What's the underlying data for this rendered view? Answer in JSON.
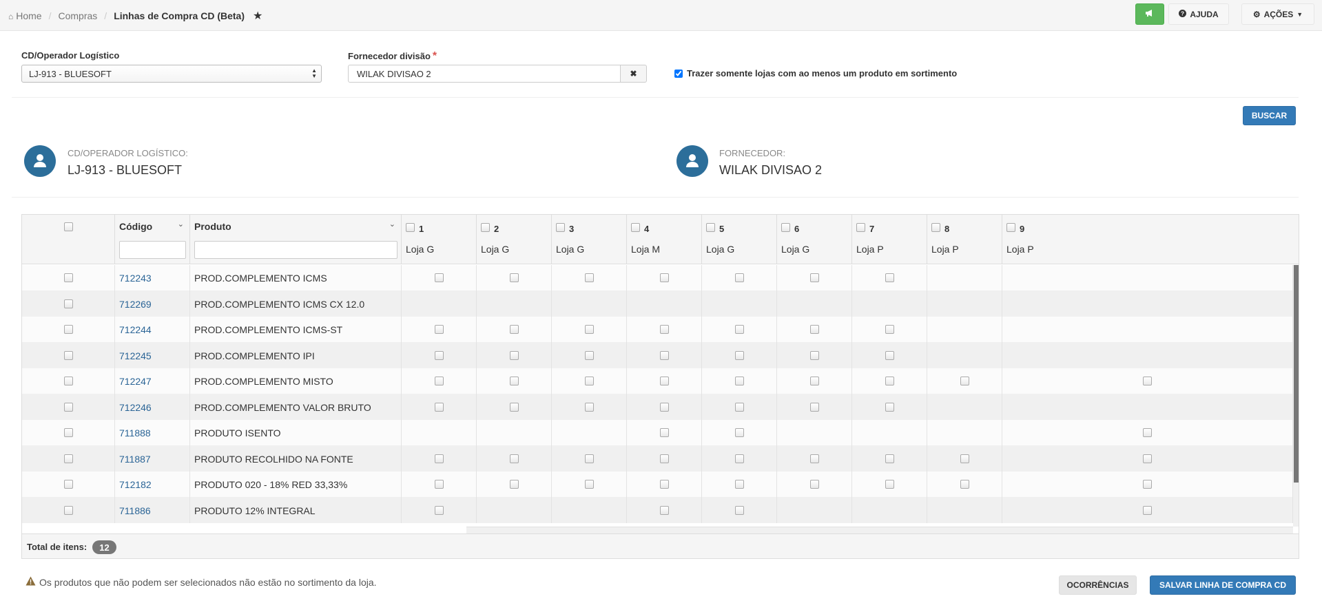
{
  "breadcrumb": {
    "home": "Home",
    "section": "Compras",
    "current": "Linhas de Compra CD (Beta)"
  },
  "toolbar": {
    "help_label": "AJUDA",
    "actions_label": "AÇÕES"
  },
  "filters": {
    "cd_label": "CD/Operador Logístico",
    "cd_value": "LJ-913 - BLUESOFT",
    "supplier_label": "Fornecedor divisão",
    "supplier_required": "*",
    "supplier_value": "WILAK DIVISAO 2",
    "only_stores_label": "Trazer somente lojas com ao menos um produto em sortimento",
    "only_stores_checked": true,
    "search_button": "BUSCAR"
  },
  "summary": {
    "cd_label": "CD/OPERADOR LOGÍSTICO:",
    "cd_value": "LJ-913 - BLUESOFT",
    "supplier_label": "FORNECEDOR:",
    "supplier_value": "WILAK DIVISAO 2"
  },
  "grid": {
    "code_header": "Código",
    "product_header": "Produto",
    "stores": [
      {
        "num": "1",
        "name": "Loja G"
      },
      {
        "num": "2",
        "name": "Loja G"
      },
      {
        "num": "3",
        "name": "Loja G"
      },
      {
        "num": "4",
        "name": "Loja M"
      },
      {
        "num": "5",
        "name": "Loja G"
      },
      {
        "num": "6",
        "name": "Loja G"
      },
      {
        "num": "7",
        "name": "Loja P"
      },
      {
        "num": "8",
        "name": "Loja P"
      },
      {
        "num": "9",
        "name": "Loja P"
      }
    ],
    "rows": [
      {
        "code": "712243",
        "product": "PROD.COMPLEMENTO ICMS",
        "avail": [
          1,
          1,
          1,
          1,
          1,
          1,
          1,
          0,
          0
        ]
      },
      {
        "code": "712269",
        "product": "PROD.COMPLEMENTO ICMS CX 12.0",
        "avail": [
          0,
          0,
          0,
          0,
          0,
          0,
          0,
          0,
          0
        ]
      },
      {
        "code": "712244",
        "product": "PROD.COMPLEMENTO ICMS-ST",
        "avail": [
          1,
          1,
          1,
          1,
          1,
          1,
          1,
          0,
          0
        ]
      },
      {
        "code": "712245",
        "product": "PROD.COMPLEMENTO IPI",
        "avail": [
          1,
          1,
          1,
          1,
          1,
          1,
          1,
          0,
          0
        ]
      },
      {
        "code": "712247",
        "product": "PROD.COMPLEMENTO MISTO",
        "avail": [
          1,
          1,
          1,
          1,
          1,
          1,
          1,
          1,
          1
        ]
      },
      {
        "code": "712246",
        "product": "PROD.COMPLEMENTO VALOR BRUTO",
        "avail": [
          1,
          1,
          1,
          1,
          1,
          1,
          1,
          0,
          0
        ]
      },
      {
        "code": "711888",
        "product": "PRODUTO ISENTO",
        "avail": [
          0,
          0,
          0,
          1,
          1,
          0,
          0,
          0,
          1
        ]
      },
      {
        "code": "711887",
        "product": "PRODUTO RECOLHIDO NA FONTE",
        "avail": [
          1,
          1,
          1,
          1,
          1,
          1,
          1,
          1,
          1
        ]
      },
      {
        "code": "712182",
        "product": "PRODUTO 020 - 18% RED 33,33%",
        "avail": [
          1,
          1,
          1,
          1,
          1,
          1,
          1,
          1,
          1
        ]
      },
      {
        "code": "711886",
        "product": "PRODUTO 12% INTEGRAL",
        "avail": [
          1,
          0,
          0,
          1,
          1,
          0,
          0,
          0,
          1
        ]
      }
    ],
    "total_label": "Total de itens:",
    "total_count": "12"
  },
  "footer": {
    "warning": "Os produtos que não podem ser selecionados não estão no sortimento da loja.",
    "occurrences_button": "OCORRÊNCIAS",
    "save_button": "SALVAR LINHA DE COMPRA CD"
  },
  "colors": {
    "primary": "#337ab7",
    "success": "#5cb85c",
    "avatar": "#2c6e9a",
    "link": "#2a6496",
    "required": "#d9534f",
    "warning_icon": "#8a6d3b"
  }
}
